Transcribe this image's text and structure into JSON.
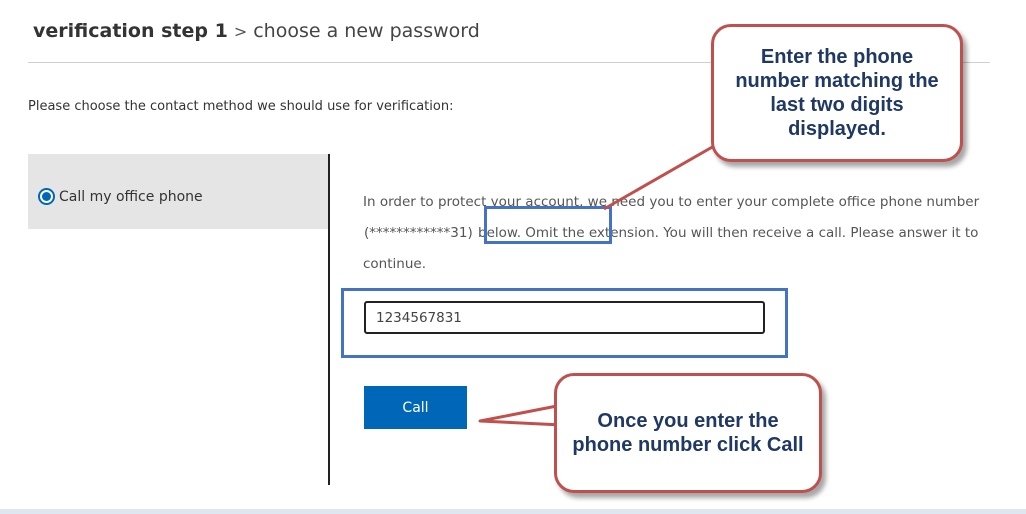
{
  "header": {
    "step": "verification step 1",
    "separator": ">",
    "subtitle": "choose a new password"
  },
  "prompt": "Please choose the contact method we should use for verification:",
  "method": {
    "label": "Call my office phone",
    "selected": true
  },
  "instructions": {
    "before": "In order to protect your account, we need you to enter your complete office phone number ",
    "masked": "(************31)",
    "after": " below. Omit the extension. You will then receive a call. Please answer it to continue."
  },
  "phone_input": {
    "value": "1234567831"
  },
  "call_button": {
    "label": "Call"
  },
  "callouts": {
    "top": "Enter the phone number matching the last two digits displayed.",
    "bottom": "Once you enter the phone number click Call"
  },
  "colors": {
    "accent": "#0067b8",
    "callout_border": "#c0504d",
    "callout_text": "#1f3864",
    "highlight": "#4472c4"
  }
}
